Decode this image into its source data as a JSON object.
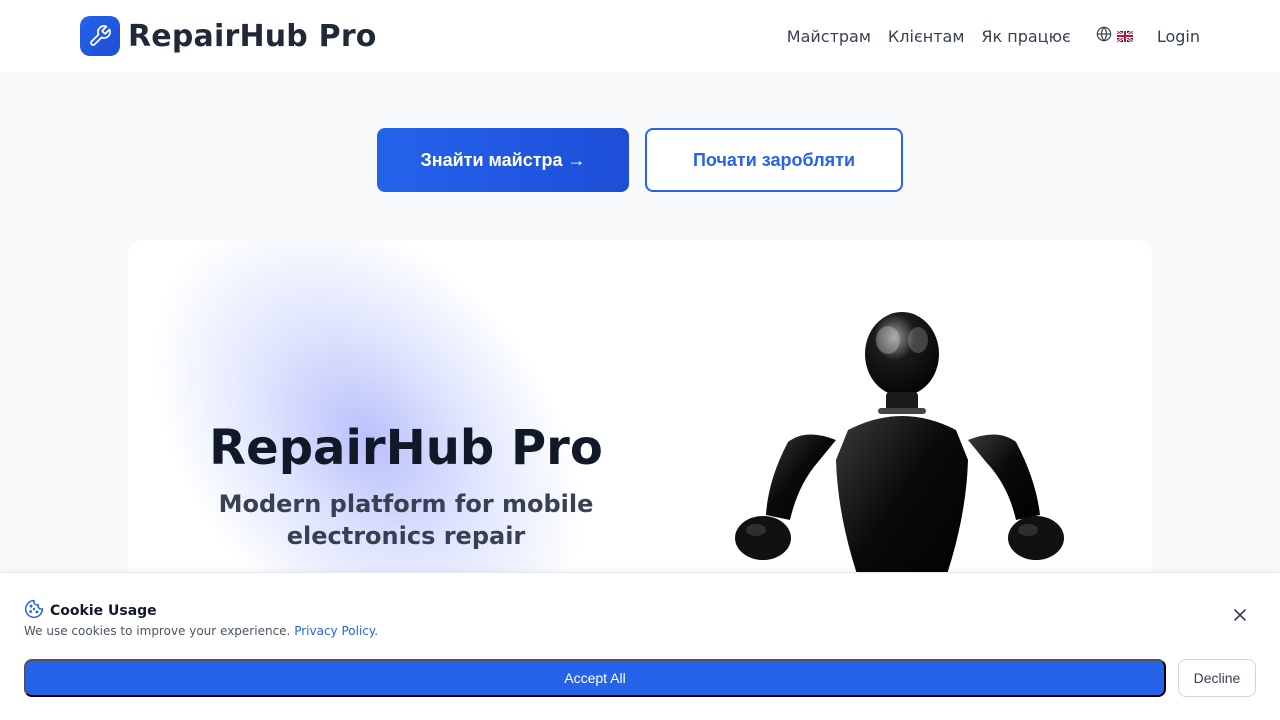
{
  "header": {
    "logo_text": "RepairHub Pro",
    "logo_icon": "wrench-icon",
    "nav": [
      {
        "label": "Майстрам"
      },
      {
        "label": "Клієнтам"
      },
      {
        "label": "Як працює"
      }
    ],
    "language_icon": "globe-icon",
    "language_flag": "uk-flag-icon",
    "login_label": "Login"
  },
  "hero": {
    "primary_button": "Знайти майстра →",
    "secondary_button": "Почати заробляти",
    "title": "RepairHub Pro",
    "subtitle": "Modern platform for mobile electronics repair"
  },
  "cookie_banner": {
    "icon": "cookie-icon",
    "title": "Cookie Usage",
    "text": "We use cookies to improve your experience.",
    "link_label": "Privacy Policy",
    "link_suffix": ".",
    "accept_label": "Accept All",
    "decline_label": "Decline",
    "close_icon": "close-icon"
  },
  "colors": {
    "accent": "#2563eb",
    "text_dark": "#111827",
    "background": "#f8fafc"
  }
}
